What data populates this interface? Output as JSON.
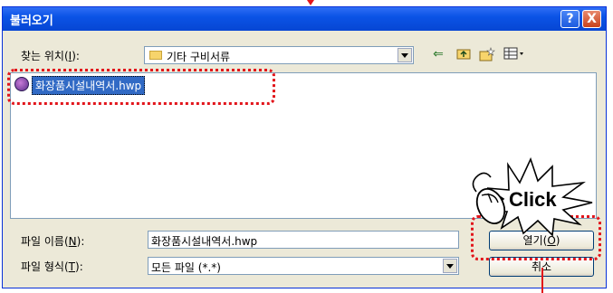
{
  "dialog": {
    "title": "불러오기",
    "help_label": "?",
    "close_label": "X"
  },
  "look_in": {
    "label_prefix": "찾는 위치(",
    "label_key": "I",
    "label_suffix": "):",
    "value": "기타 구비서류"
  },
  "files": [
    {
      "name": "화장품시설내역서.hwp",
      "selected": true
    }
  ],
  "file_name_field": {
    "label_prefix": "파일 이름(",
    "label_key": "N",
    "label_suffix": "):",
    "value": "화장품시설내역서.hwp"
  },
  "file_type_field": {
    "label_prefix": "파일 형식(",
    "label_key": "T",
    "label_suffix": "):",
    "value": "모든 파일 (*.*)"
  },
  "buttons": {
    "open_prefix": "열기(",
    "open_key": "O",
    "open_suffix": ")",
    "cancel": "취소"
  },
  "annotation": {
    "click_text": "Click"
  },
  "colors": {
    "titlebar": "#0b53e6",
    "selection": "#316ac5",
    "highlight_red": "#e2151b"
  }
}
